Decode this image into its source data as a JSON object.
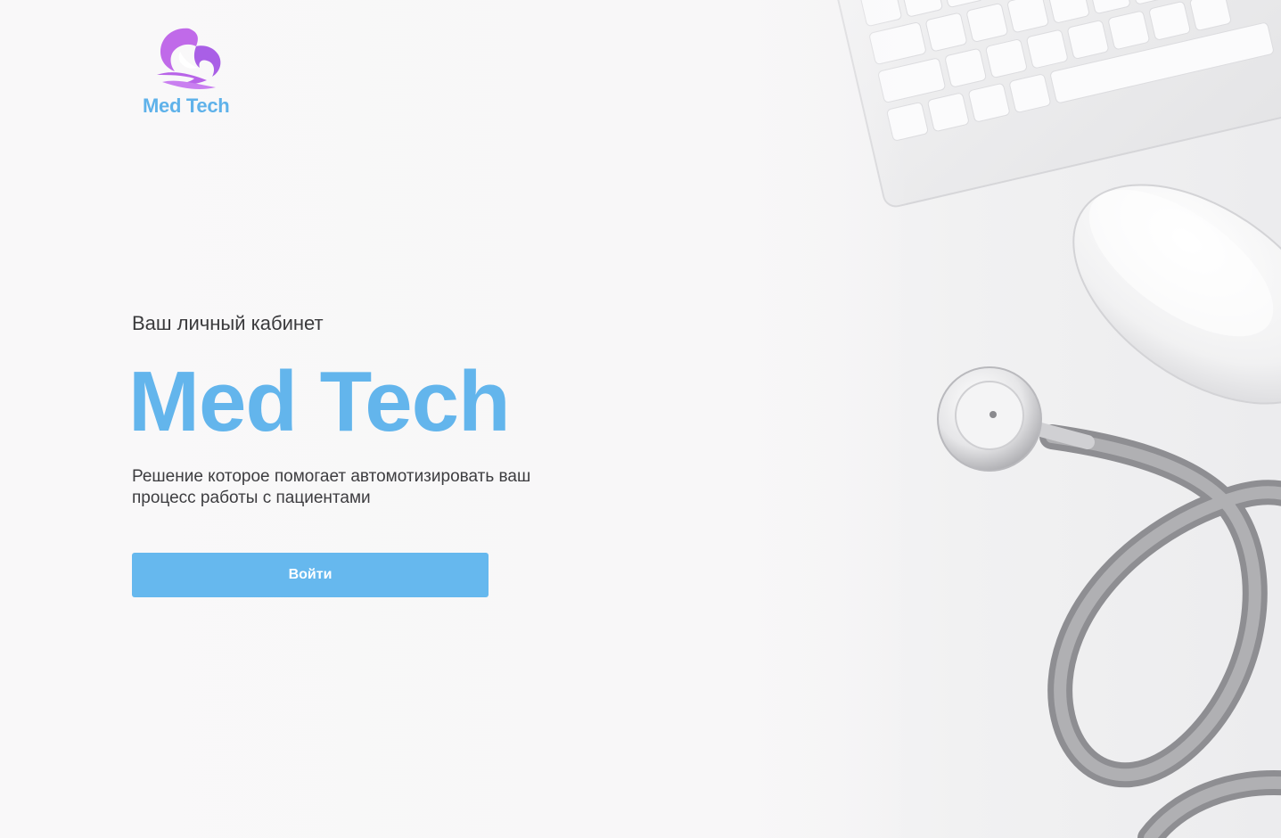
{
  "logo": {
    "text": "Med Tech",
    "icon": "woman-silhouette-icon"
  },
  "hero": {
    "subtitle": "Ваш личный кабинет",
    "title": "Med Tech",
    "description": "Решение которое помогает автомотизировать ваш процесс работы с пациентами"
  },
  "actions": {
    "login_label": "Войти"
  },
  "colors": {
    "accent": "#63b5ec",
    "logo_purple": "#b964e8",
    "text": "#3a3a3c",
    "background": "#f8f7f8"
  }
}
